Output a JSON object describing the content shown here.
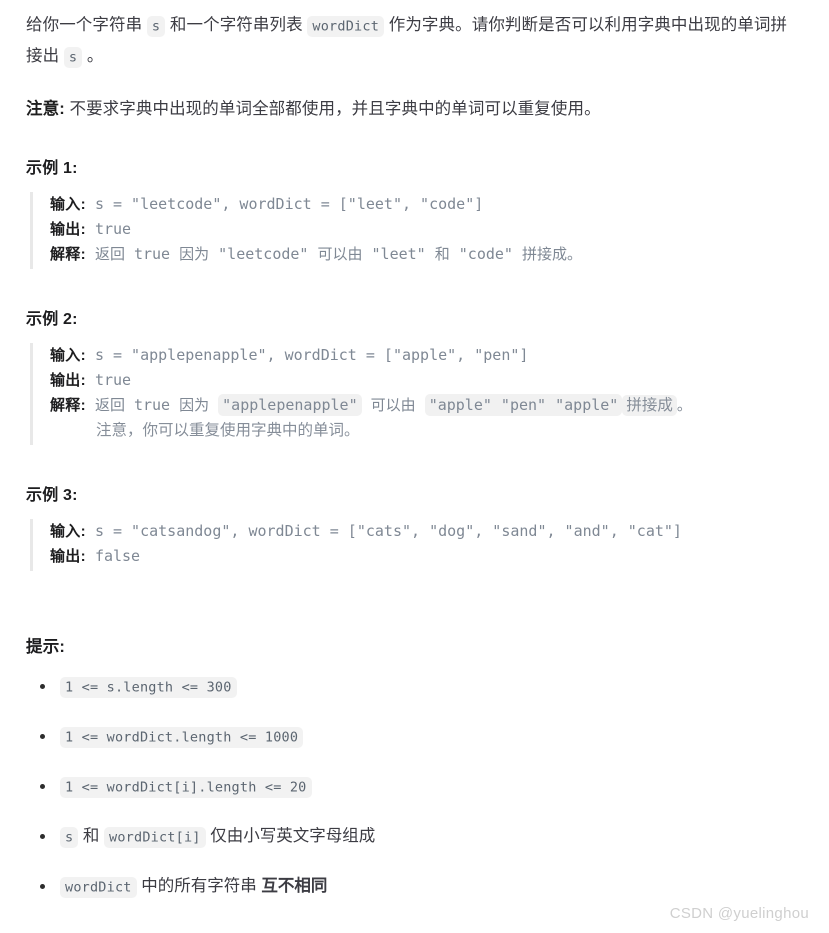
{
  "problem": {
    "intro": {
      "seg1": "给你一个字符串",
      "code_s_1": "s",
      "seg2": "和一个字符串列表",
      "code_worddict": "wordDict",
      "seg3": "作为字典。请你判断是否可以利用字典中出现的单词拼接出",
      "code_s_2": "s",
      "seg4": "。"
    },
    "note": {
      "label": "注意:",
      "text": "不要求字典中出现的单词全部都使用，并且字典中的单词可以重复使用。"
    },
    "labels": {
      "input": "输入:",
      "output": "输出:",
      "explain": "解释:"
    },
    "examples": [
      {
        "title": "示例 1:",
        "input": "s = \"leetcode\", wordDict = [\"leet\", \"code\"]",
        "output": "true",
        "explain_parts": {
          "p1": "返回 true 因为 \"leetcode\" 可以由 \"leet\" 和 \"code\" 拼接成。"
        }
      },
      {
        "title": "示例 2:",
        "input": "s = \"applepenapple\", wordDict = [\"apple\", \"pen\"]",
        "output": "true",
        "explain_parts": {
          "a": "返回 true 因为 ",
          "hl1": "\"applepenapple\"",
          "b": " 可以由 ",
          "hl2": "\"apple\" \"pen\" \"apple\"",
          "hl3": "拼接成",
          "c": "。",
          "line2": "注意，你可以重复使用字典中的单词。"
        }
      },
      {
        "title": "示例 3:",
        "input": "s = \"catsandog\", wordDict = [\"cats\", \"dog\", \"sand\", \"and\", \"cat\"]",
        "output": "false"
      }
    ],
    "hints": {
      "title": "提示:",
      "items": [
        {
          "code": "1 <= s.length <= 300",
          "text": ""
        },
        {
          "code": "1 <= wordDict.length <= 1000",
          "text": ""
        },
        {
          "code": "1 <= wordDict[i].length <= 20",
          "text": ""
        },
        {
          "code": "s",
          "mid_text": "和",
          "code2": "wordDict[i]",
          "text": "仅由小写英文字母组成"
        },
        {
          "code": "wordDict",
          "text": "中的所有字符串",
          "bold_text": "互不相同"
        }
      ]
    }
  },
  "watermark": "CSDN @yuelinghou"
}
